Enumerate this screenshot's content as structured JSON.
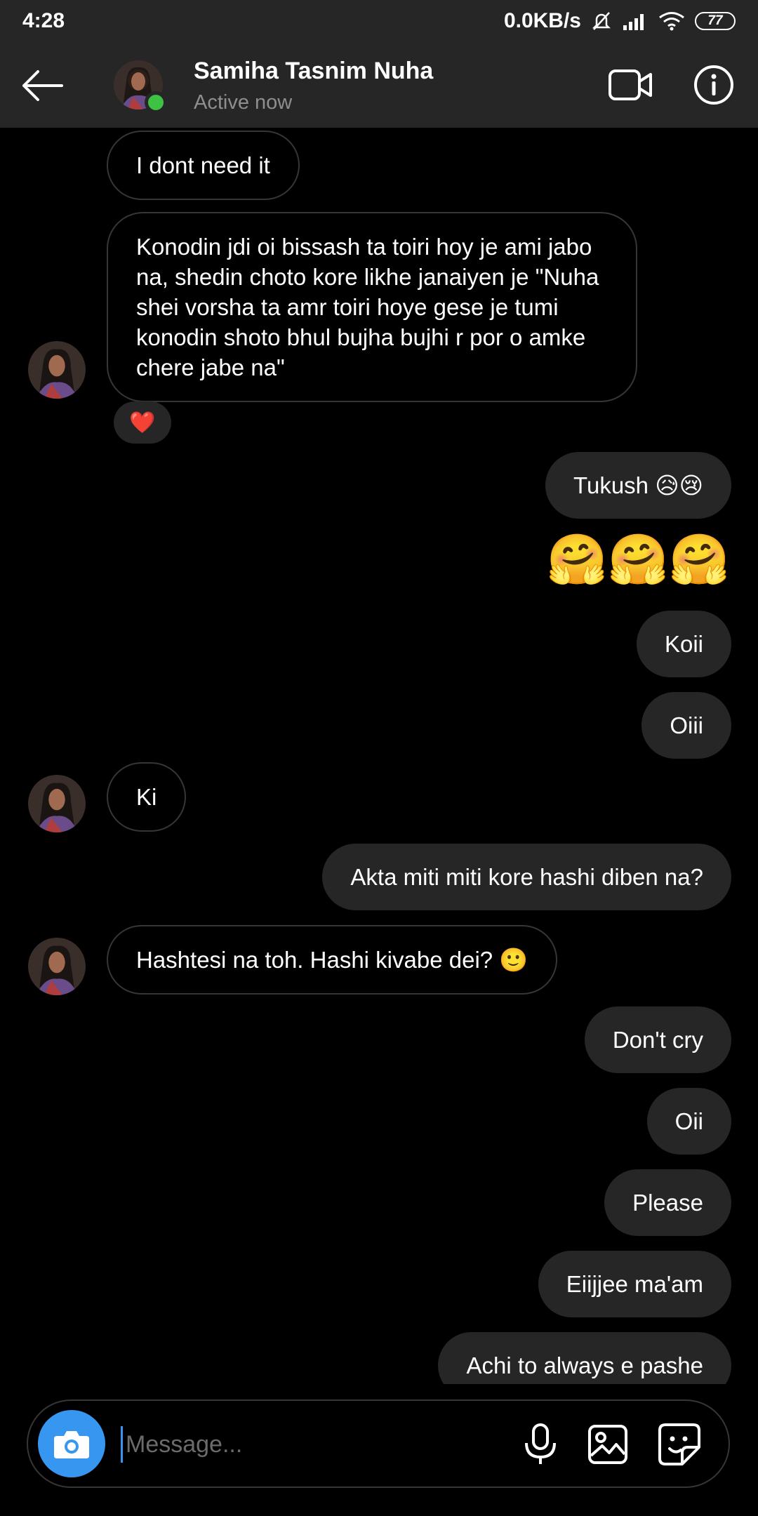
{
  "status_bar": {
    "time": "4:28",
    "network_speed": "0.0KB/s",
    "battery": "77"
  },
  "header": {
    "name": "Samiha Tasnim Nuha",
    "status": "Active now"
  },
  "messages": [
    {
      "from": "them",
      "text": "I dont need it"
    },
    {
      "from": "them",
      "text": "Konodin jdi oi bissash ta toiri hoy je ami jabo na, shedin choto kore likhe janaiyen je \"Nuha shei vorsha ta amr toiri hoye gese je tumi konodin shoto bhul bujha bujhi r por o amke chere jabe na\"",
      "reaction": "❤️"
    },
    {
      "from": "me",
      "text": "Tukush 😥😢"
    },
    {
      "from": "me",
      "text": "🤗🤗🤗"
    },
    {
      "from": "me",
      "text": "Koii"
    },
    {
      "from": "me",
      "text": "Oiii"
    },
    {
      "from": "them",
      "text": "Ki"
    },
    {
      "from": "me",
      "text": "Akta miti miti kore hashi diben na?"
    },
    {
      "from": "them",
      "text": "Hashtesi na toh. Hashi kivabe dei? 🙂"
    },
    {
      "from": "me",
      "text": "Don't cry"
    },
    {
      "from": "me",
      "text": "Oii"
    },
    {
      "from": "me",
      "text": "Please"
    },
    {
      "from": "me",
      "text": "Eiijjee ma'am"
    },
    {
      "from": "me",
      "text": "Achi to always e pashe"
    }
  ],
  "composer": {
    "placeholder": "Message..."
  },
  "icons": [
    "back-arrow-icon",
    "video-call-icon",
    "info-icon",
    "camera-icon",
    "microphone-icon",
    "gallery-icon",
    "sticker-icon"
  ],
  "colors": {
    "background": "#000000",
    "bar": "#262626",
    "outgoing_bubble": "#262626",
    "incoming_border": "#363636",
    "online": "#3ec244",
    "accent": "#3797f0"
  }
}
